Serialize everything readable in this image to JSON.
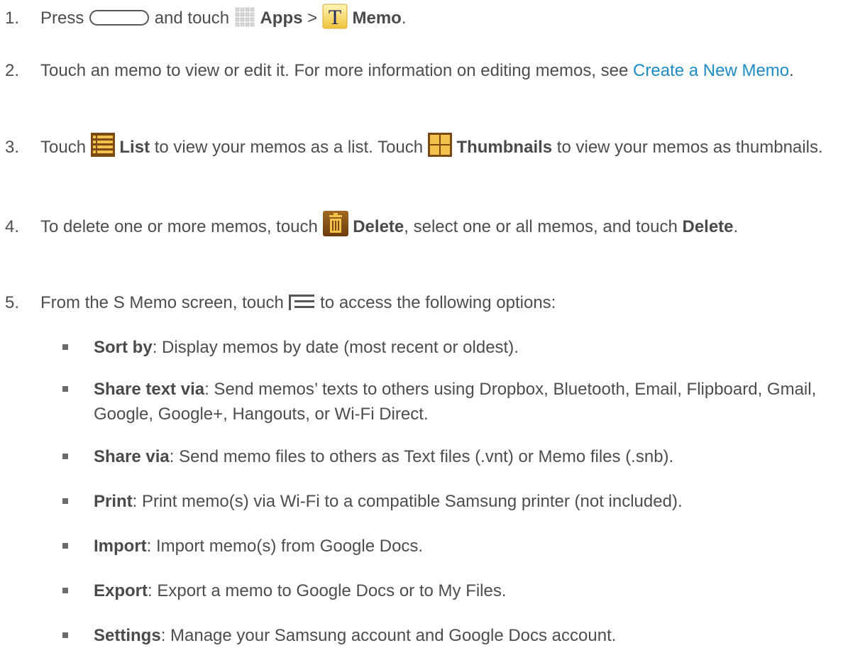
{
  "steps": {
    "s1": {
      "num": "1.",
      "t1": "Press",
      "t2": "and touch",
      "apps": "Apps",
      "gt": ">",
      "memo_glyph": "T",
      "memo": "Memo",
      "end": "."
    },
    "s2": {
      "num": "2.",
      "t1": "Touch an memo to view or edit it. For more information on editing memos, see",
      "link": "Create a New Memo",
      "end": "."
    },
    "s3": {
      "num": "3.",
      "t1": "Touch",
      "list": "List",
      "t2": "to view your memos as a list. Touch",
      "thumbs": "Thumbnails",
      "t3": "to view your memos as thumbnails."
    },
    "s4": {
      "num": "4.",
      "t1": "To delete one or more memos, touch",
      "del": "Delete",
      "t2": ", select one or all memos, and touch",
      "del2": "Delete",
      "end": "."
    },
    "s5": {
      "num": "5.",
      "t1": "From the S Memo screen, touch",
      "t2": "to access the following options:"
    }
  },
  "options": [
    {
      "term": "Sort by",
      "desc": ": Display memos by date (most recent or oldest)."
    },
    {
      "term": "Share text via",
      "desc": ": Send memos’ texts to others using Dropbox, Bluetooth, Email, Flipboard, Gmail, Google, Google+, Hangouts, or Wi-Fi Direct."
    },
    {
      "term": "Share via",
      "desc": ": Send memo files to others as Text files (.vnt) or Memo files (.snb)."
    },
    {
      "term": "Print",
      "desc": ": Print memo(s) via Wi-Fi to a compatible Samsung printer (not included)."
    },
    {
      "term": "Import",
      "desc": ": Import memo(s) from Google Docs."
    },
    {
      "term": "Export",
      "desc": ": Export a memo to Google Docs or to My Files."
    },
    {
      "term": "Settings",
      "desc": ": Manage your Samsung account and Google Docs account."
    }
  ],
  "colors": {
    "text": "#4d4d4d",
    "link": "#1f8bc4",
    "icon_brown": "#7a4a12",
    "icon_yellow": "#f2c24a"
  },
  "icons": [
    "home-key-icon",
    "apps-grid-icon",
    "memo-app-icon",
    "list-view-icon",
    "thumbnails-view-icon",
    "delete-icon",
    "menu-key-icon",
    "bullet-square-icon"
  ]
}
